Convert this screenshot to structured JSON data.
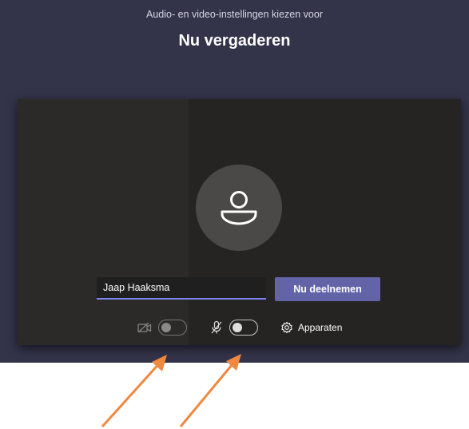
{
  "header": {
    "subtitle": "Audio- en video-instellingen kiezen voor",
    "title": "Nu vergaderen"
  },
  "join": {
    "name_value": "Jaap Haaksma",
    "join_label": "Nu deelnemen"
  },
  "controls": {
    "camera_icon": "video-off-icon",
    "camera_enabled": false,
    "mic_icon": "mic-off-icon",
    "mic_enabled": false,
    "devices_icon": "gear-icon",
    "devices_label": "Apparaten"
  },
  "colors": {
    "background": "#33344a",
    "panel": "#252423",
    "accent": "#6264a7",
    "annotation_arrow": "#f0883e"
  }
}
